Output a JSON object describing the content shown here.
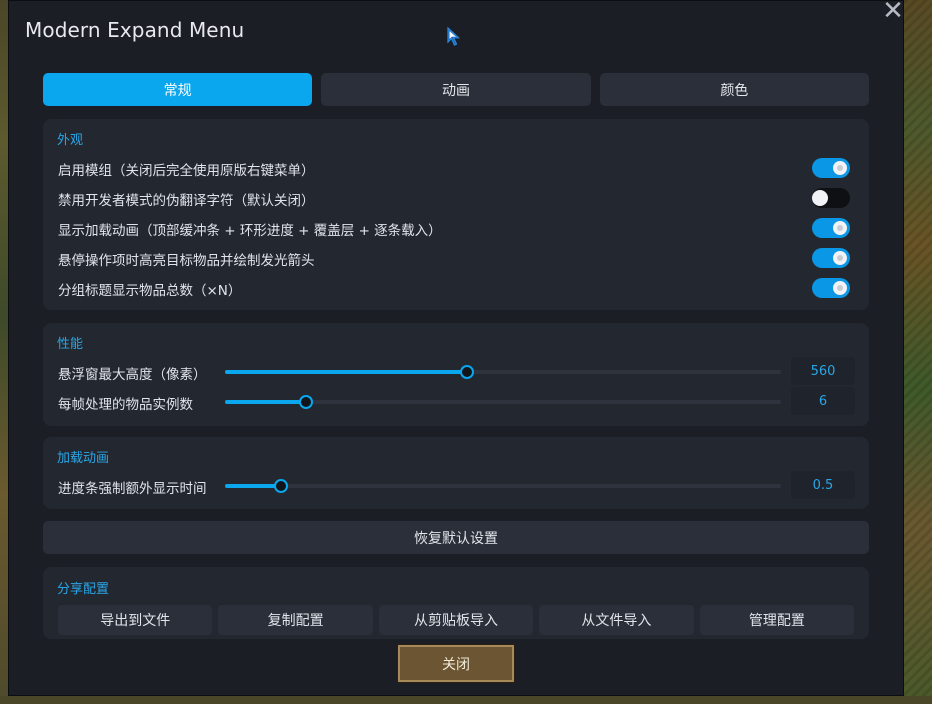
{
  "window": {
    "title": "Modern Expand Menu",
    "close_glyph": "✕"
  },
  "tabs": [
    {
      "label": "常规",
      "active": true
    },
    {
      "label": "动画",
      "active": false
    },
    {
      "label": "颜色",
      "active": false
    }
  ],
  "appearance": {
    "title": "外观",
    "options": [
      {
        "label": "启用模组（关闭后完全使用原版右键菜单）",
        "enabled": true
      },
      {
        "label": "禁用开发者模式的伪翻译字符（默认关闭）",
        "enabled": false
      },
      {
        "label": "显示加载动画（顶部缓冲条 + 环形进度 + 覆盖层 + 逐条载入）",
        "enabled": true
      },
      {
        "label": "悬停操作项时高亮目标物品并绘制发光箭头",
        "enabled": true
      },
      {
        "label": "分组标题显示物品总数（×N）",
        "enabled": true
      }
    ]
  },
  "performance": {
    "title": "性能",
    "sliders": [
      {
        "label": "悬浮窗最大高度（像素）",
        "value": "560",
        "level": 0.435
      },
      {
        "label": "每帧处理的物品实例数",
        "value": "6",
        "level": 0.145
      }
    ]
  },
  "loading": {
    "title": "加载动画",
    "sliders": [
      {
        "label": "进度条强制额外显示时间",
        "value": "0.5",
        "level": 0.1
      }
    ]
  },
  "reset_label": "恢复默认设置",
  "share": {
    "title": "分享配置",
    "buttons": [
      "导出到文件",
      "复制配置",
      "从剪贴板导入",
      "从文件导入",
      "管理配置"
    ]
  },
  "close_label": "关闭",
  "colors": {
    "accent": "#0aa6ee",
    "panel": "#23272f",
    "window": "#1b1e25",
    "close_button": "#6b5532"
  },
  "icons": {
    "cursor": "pointer-cursor-icon",
    "close": "close-icon"
  }
}
